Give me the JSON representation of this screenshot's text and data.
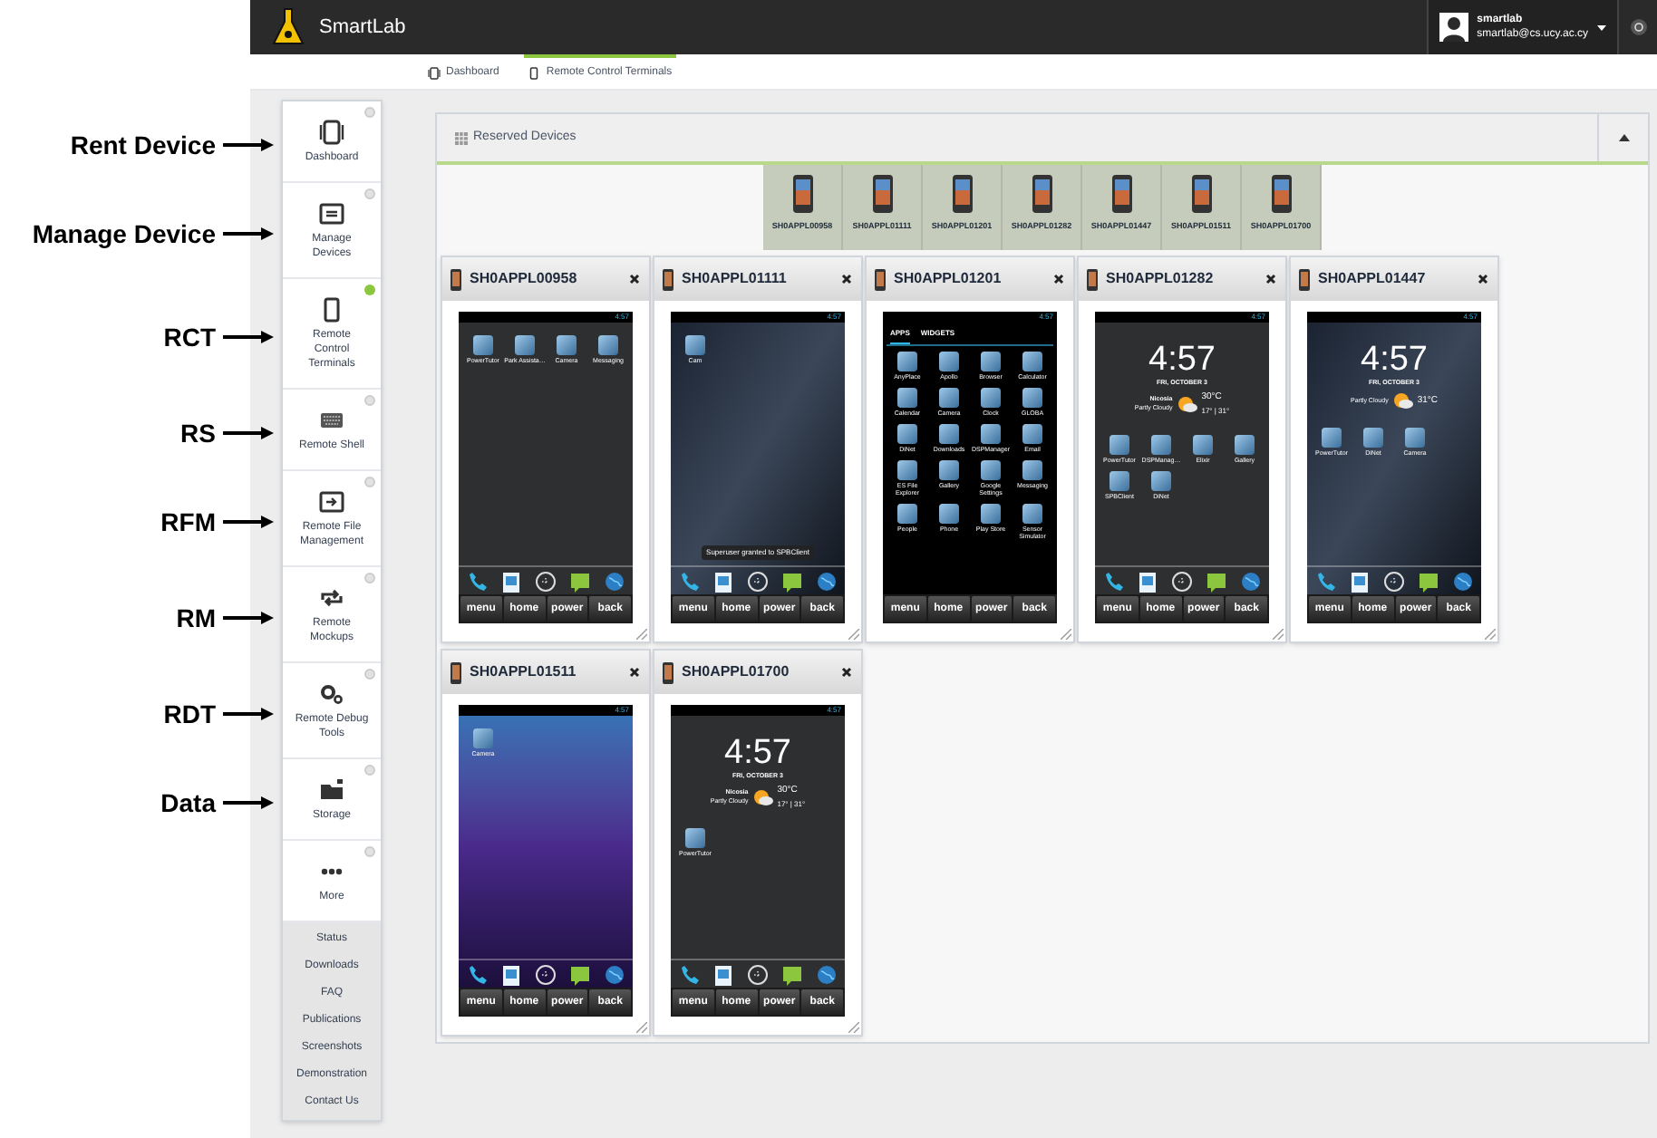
{
  "annotations": [
    "Rent Device",
    "Manage Device",
    "RCT",
    "RS",
    "RFM",
    "RM",
    "RDT",
    "Data"
  ],
  "top_bar": {
    "app_name": "SmartLab",
    "user_name": "smartlab",
    "user_email": "smartlab@cs.ucy.ac.cy"
  },
  "breadcrumb": [
    {
      "label": "Dashboard",
      "kind": "dashboard",
      "selected": false
    },
    {
      "label": "Remote Control Terminals",
      "kind": "phone",
      "selected": true
    }
  ],
  "sidebar": {
    "items": [
      {
        "label": "Dashboard",
        "kind": "dashboard",
        "selected": false
      },
      {
        "label": "Manage Devices",
        "kind": "manage",
        "selected": false
      },
      {
        "label": "Remote Control Terminals",
        "kind": "phone",
        "selected": true
      },
      {
        "label": "Remote Shell",
        "kind": "shell",
        "selected": false
      },
      {
        "label": "Remote File Management",
        "kind": "files",
        "selected": false
      },
      {
        "label": "Remote Mockups",
        "kind": "mockups",
        "selected": false
      },
      {
        "label": "Remote Debug Tools",
        "kind": "debug",
        "selected": false
      },
      {
        "label": "Storage",
        "kind": "storage",
        "selected": false
      },
      {
        "label": "More",
        "kind": "more",
        "selected": false
      }
    ],
    "links": [
      "Status",
      "Downloads",
      "FAQ",
      "Publications",
      "Screenshots",
      "Demonstration",
      "Contact Us"
    ]
  },
  "reserved_devices": {
    "title": "Reserved Devices",
    "devices": [
      "SH0APPL00958",
      "SH0APPL01111",
      "SH0APPL01201",
      "SH0APPL01282",
      "SH0APPL01447",
      "SH0APPL01511",
      "SH0APPL01700"
    ]
  },
  "terminals": [
    {
      "name": "SH0APPL00958",
      "buttons": [
        "menu",
        "home",
        "power",
        "back"
      ],
      "screen": {
        "kind": "home",
        "wallpaper": {
          "kind": "pattern"
        },
        "status_time": "4:57",
        "apps": [
          "PowerTutor",
          "Park Assista…",
          "Camera",
          "Messaging"
        ]
      }
    },
    {
      "name": "SH0APPL01111",
      "buttons": [
        "menu",
        "home",
        "power",
        "back"
      ],
      "screen": {
        "kind": "home",
        "wallpaper": {
          "kind": "rays"
        },
        "status_time": "4:57",
        "apps": [
          "Cam"
        ],
        "toast": "Superuser granted to SPBClient"
      }
    },
    {
      "name": "SH0APPL01201",
      "buttons": [
        "menu",
        "home",
        "power",
        "back"
      ],
      "screen": {
        "kind": "drawer",
        "wallpaper": {
          "kind": "black"
        },
        "status_time": "4:57",
        "tabs": [
          {
            "label": "APPS",
            "selected": true
          },
          {
            "label": "WIDGETS",
            "selected": false
          }
        ],
        "apps": [
          "AnyPlace",
          "Apollo",
          "Browser",
          "Calculator",
          "Calendar",
          "Camera",
          "Clock",
          "GLOBA",
          "DiNet",
          "Downloads",
          "DSPManager",
          "Email",
          "ES File Explorer",
          "Gallery",
          "Google Settings",
          "Messaging",
          "People",
          "Phone",
          "Play Store",
          "Sensor Simulator"
        ]
      }
    },
    {
      "name": "SH0APPL01282",
      "buttons": [
        "menu",
        "home",
        "power",
        "back"
      ],
      "screen": {
        "kind": "home",
        "wallpaper": {
          "kind": "pattern"
        },
        "status_time": "4:57",
        "clock": {
          "time": "4:57",
          "date": "FRI, OCTOBER 3",
          "city": "Nicosia",
          "condition": "Partly Cloudy",
          "temperature": "30°C",
          "range": "17° | 31°"
        },
        "apps": [
          "PowerTutor",
          "DSPManag…",
          "Elixir",
          "Gallery",
          "SPBClient",
          "DiNet"
        ]
      }
    },
    {
      "name": "SH0APPL01447",
      "buttons": [
        "menu",
        "home",
        "power",
        "back"
      ],
      "screen": {
        "kind": "home",
        "wallpaper": {
          "kind": "rays"
        },
        "status_time": "4:57",
        "clock": {
          "time": "4:57",
          "date": "FRI, OCTOBER 3",
          "condition": "Partly Cloudy",
          "temperature": "31°C"
        },
        "apps": [
          "PowerTutor",
          "DiNet",
          "Camera"
        ]
      }
    },
    {
      "name": "SH0APPL01511",
      "buttons": [
        "menu",
        "home",
        "power",
        "back"
      ],
      "screen": {
        "kind": "home",
        "wallpaper": {
          "kind": "bokeh"
        },
        "status_time": "4:57",
        "apps": [
          "Camera"
        ]
      }
    },
    {
      "name": "SH0APPL01700",
      "buttons": [
        "menu",
        "home",
        "power",
        "back"
      ],
      "screen": {
        "kind": "home",
        "wallpaper": {
          "kind": "pattern"
        },
        "status_time": "4:57",
        "clock": {
          "time": "4:57",
          "date": "FRI, OCTOBER 3",
          "city": "Nicosia",
          "condition": "Partly Cloudy",
          "temperature": "30°C",
          "range": "17° | 31°"
        },
        "apps": [
          "PowerTutor"
        ]
      }
    }
  ]
}
